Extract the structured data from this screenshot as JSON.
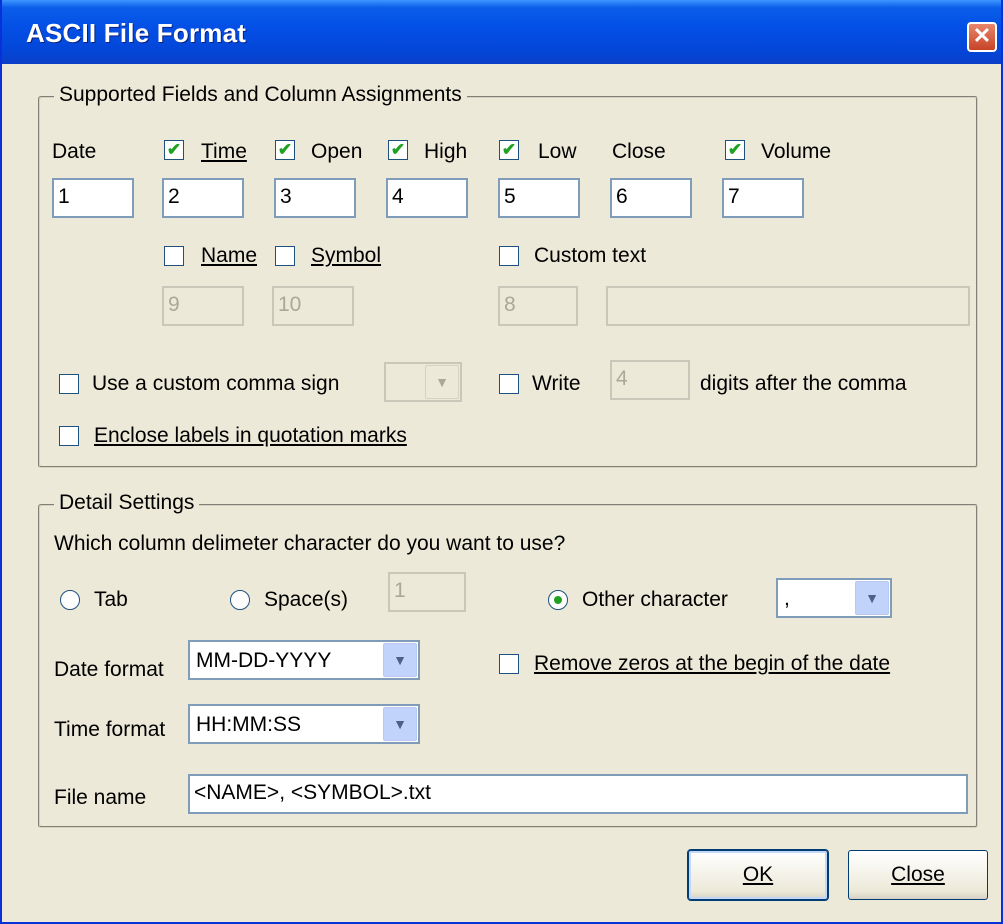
{
  "window": {
    "title": "ASCII File Format",
    "close_glyph": "✕"
  },
  "fields_group": {
    "legend": "Supported Fields and Column Assignments",
    "date_label": "Date",
    "date_value": "1",
    "time": {
      "label": "Time",
      "checked": true,
      "value": "2"
    },
    "open": {
      "label": "Open",
      "checked": true,
      "value": "3"
    },
    "high": {
      "label": "High",
      "checked": true,
      "value": "4"
    },
    "low": {
      "label": "Low",
      "checked": true,
      "value": "5"
    },
    "close_label": "Close",
    "close_value": "6",
    "volume": {
      "label": "Volume",
      "checked": true,
      "value": "7"
    },
    "name": {
      "label": "Name",
      "checked": false,
      "value": "9"
    },
    "symbol": {
      "label": "Symbol",
      "checked": false,
      "value": "10"
    },
    "custom_text": {
      "label": "Custom text",
      "checked": false,
      "value": "8",
      "text_value": ""
    },
    "custom_comma": {
      "label": "Use a custom comma sign",
      "checked": false,
      "value": ""
    },
    "write": {
      "label": "Write",
      "checked": false,
      "value": "4",
      "suffix": "digits after the comma"
    },
    "enclose_labels": {
      "label": "Enclose labels in quotation marks",
      "checked": false
    }
  },
  "detail_group": {
    "legend": "Detail Settings",
    "question": "Which column delimeter character do you want to use?",
    "tab_label": "Tab",
    "spaces_label": "Space(s)",
    "spaces_value": "1",
    "other_label": "Other character",
    "other_value": ",",
    "selected_delimiter": "other",
    "date_format_label": "Date format",
    "date_format_value": "MM-DD-YYYY",
    "remove_zeros_label": "Remove zeros at the begin of the date",
    "time_format_label": "Time format",
    "time_format_value": "HH:MM:SS",
    "file_name_label": "File name",
    "file_name_value": "<NAME>, <SYMBOL>.txt"
  },
  "buttons": {
    "ok": "OK",
    "close": "Close"
  },
  "icons": {
    "check": "✔",
    "dropdown": "▼"
  },
  "colors": {
    "titlebar": "#0450e6",
    "dialog_bg": "#ece9d8",
    "checkmark": "#21a121"
  }
}
